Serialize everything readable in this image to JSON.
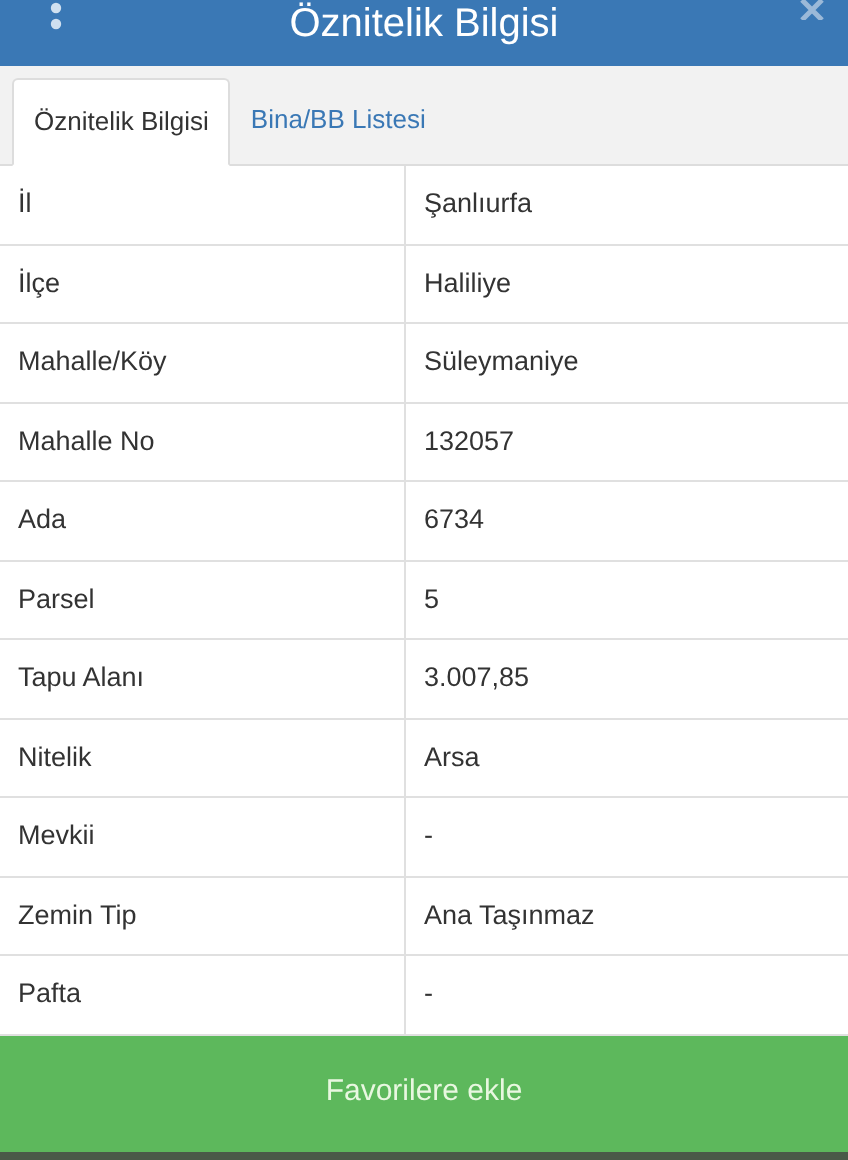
{
  "header": {
    "title": "Öznitelik Bilgisi"
  },
  "tabs": [
    {
      "label": "Öznitelik Bilgisi",
      "selected": true
    },
    {
      "label": "Bina/BB Listesi",
      "selected": false
    }
  ],
  "rows": [
    {
      "label": "İl",
      "value": "Şanlıurfa"
    },
    {
      "label": "İlçe",
      "value": "Haliliye"
    },
    {
      "label": "Mahalle/Köy",
      "value": "Süleymaniye"
    },
    {
      "label": "Mahalle No",
      "value": "132057"
    },
    {
      "label": "Ada",
      "value": "6734"
    },
    {
      "label": "Parsel",
      "value": "5"
    },
    {
      "label": "Tapu Alanı",
      "value": "3.007,85"
    },
    {
      "label": "Nitelik",
      "value": "Arsa"
    },
    {
      "label": "Mevkii",
      "value": "-"
    },
    {
      "label": "Zemin Tip",
      "value": "Ana Taşınmaz"
    },
    {
      "label": "Pafta",
      "value": "-"
    }
  ],
  "action_button": "Favorilere ekle"
}
